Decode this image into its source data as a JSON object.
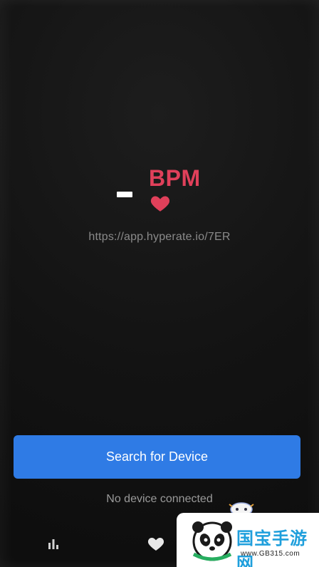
{
  "heart_rate": {
    "value": "-",
    "unit": "BPM",
    "url": "https://app.hyperate.io/7ER"
  },
  "actions": {
    "search_label": "Search for Device"
  },
  "status": {
    "connection": "No device connected"
  },
  "bottom_nav": {
    "items": [
      {
        "icon": "bar-chart-icon"
      },
      {
        "icon": "heart-icon"
      }
    ]
  },
  "watermark": {
    "brand": "国宝手游网",
    "url": "www.GB315.com"
  },
  "colors": {
    "accent_red": "#e0405a",
    "button_blue": "#2f7be5",
    "background": "#121212"
  }
}
